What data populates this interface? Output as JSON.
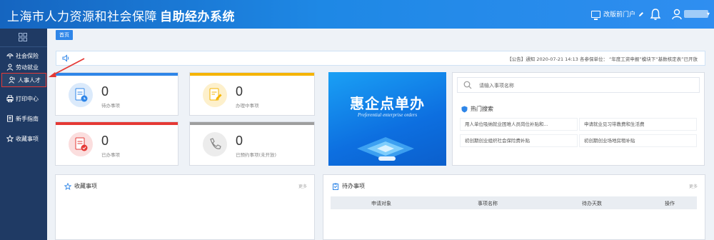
{
  "header": {
    "title_main": "上海市人力资源和社会保障",
    "title_sub": "自助经办系统",
    "link_label": "改版前门户",
    "icons": [
      "monitor-icon",
      "edit-icon",
      "bell-icon",
      "user-icon"
    ]
  },
  "sidebar": {
    "items": [
      {
        "label": "社会保险",
        "icon": "umbrella-icon"
      },
      {
        "label": "劳动就业",
        "icon": "person-icon"
      },
      {
        "label": "人事人才",
        "icon": "people-icon"
      },
      {
        "label": "打印中心",
        "icon": "printer-icon"
      },
      {
        "label": "新手指南",
        "icon": "book-icon"
      },
      {
        "label": "收藏事项",
        "icon": "star-icon"
      }
    ]
  },
  "tabs": {
    "home": "首页"
  },
  "notice": {
    "text": "【公告】通知 2020-07-21 14:13 各参保单位： “年度工资申报”模块下“基数核定表”已开放"
  },
  "cards": [
    {
      "count": "0",
      "label": "待办事项",
      "color": "#2f86e8",
      "icon": "doc-clock-icon"
    },
    {
      "count": "0",
      "label": "办理中事项",
      "color": "#f5b400",
      "icon": "doc-edit-icon"
    },
    {
      "count": "0",
      "label": "已办事项",
      "color": "#e53935",
      "icon": "doc-check-icon"
    },
    {
      "count": "0",
      "label": "已预约事项(未开放)",
      "color": "#9e9e9e",
      "icon": "phone-icon"
    }
  ],
  "banner": {
    "title": "惠企点单办",
    "subtitle": "Preferential enterprise orders"
  },
  "search": {
    "placeholder": "请输入事项名称",
    "hot_title": "热门搜索",
    "hot_items": [
      "用人单位吸纳就业困难人员岗位补贴和...",
      "申请就业见习带教费和生活费",
      "初创期创业组织社会保险费补贴",
      "初创期创业场地房租补贴"
    ]
  },
  "favorites": {
    "title": "收藏事项",
    "more": "更多"
  },
  "todo": {
    "title": "待办事项",
    "more": "更多",
    "columns": [
      "申请对象",
      "事项名称",
      "待办天数",
      "操作"
    ]
  },
  "colors": {
    "header": "#1e88e5",
    "sidebar": "#1f3a64",
    "highlight": "#e53935"
  }
}
